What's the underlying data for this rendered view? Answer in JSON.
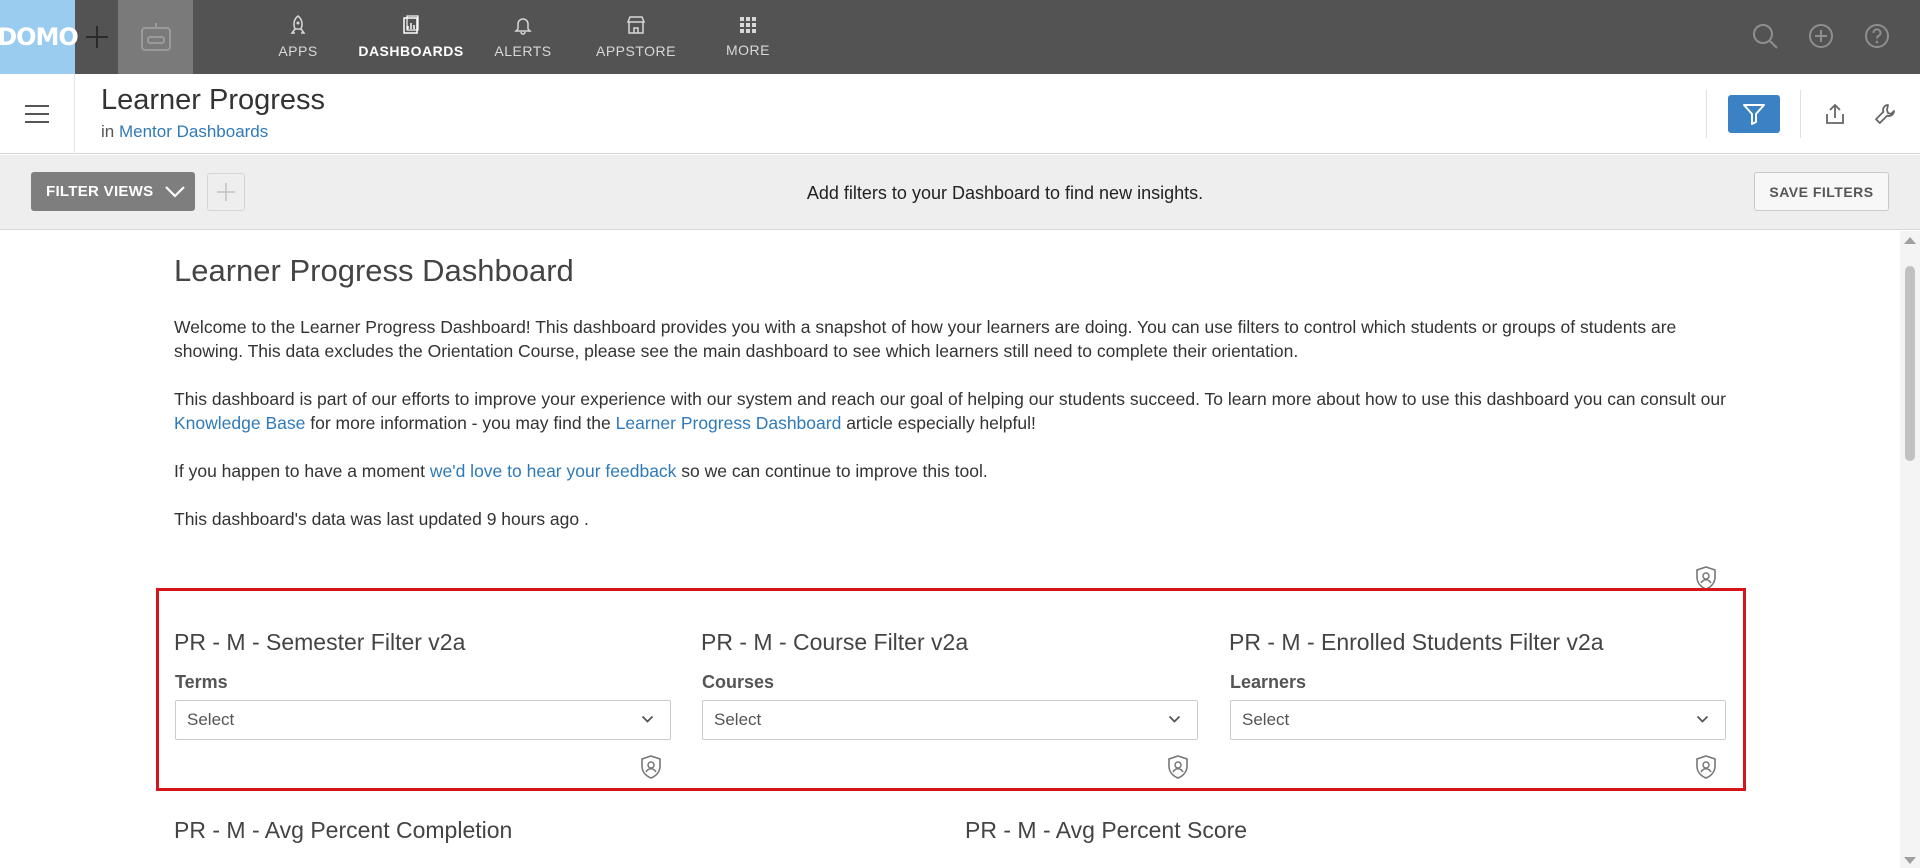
{
  "brand": {
    "logo_text": "DOMO"
  },
  "nav": {
    "items": [
      {
        "label": "APPS",
        "icon": "rocket-icon"
      },
      {
        "label": "DASHBOARDS",
        "icon": "dashboard-icon",
        "active": true
      },
      {
        "label": "ALERTS",
        "icon": "bell-icon"
      },
      {
        "label": "APPSTORE",
        "icon": "store-icon"
      },
      {
        "label": "MORE",
        "icon": "grid-icon"
      }
    ],
    "right_icons": [
      "search-icon",
      "plus-circle-icon",
      "help-icon"
    ]
  },
  "header": {
    "title": "Learner Progress",
    "in_prefix": "in",
    "parent_link": "Mentor Dashboards"
  },
  "filterbar": {
    "filter_views_label": "FILTER VIEWS",
    "message": "Add filters to your Dashboard to find new insights.",
    "save_label": "SAVE FILTERS"
  },
  "main": {
    "title": "Learner Progress Dashboard",
    "para1": "Welcome  to the Learner Progress Dashboard! This dashboard provides you with a snapshot of how your learners are doing. You can use filters to control which students or groups of students are showing. This data excludes the Orientation Course, please see the main dashboard to see which learners still need to complete their orientation.",
    "para2_a": "This dashboard is part of our efforts to improve your experience with our system and reach our goal of helping our students succeed. To learn more about how to use this dashboard you can consult our ",
    "para2_link1": "Knowledge Base",
    "para2_b": " for more information - you may find the ",
    "para2_link2": "Learner Progress Dashboard",
    "para2_c": " article especially helpful!",
    "para3_a": "If you happen to have a moment ",
    "para3_link": "we'd love to hear your feedback",
    "para3_b": " so we can continue to improve this tool.",
    "para4": "This dashboard's data was last updated  9 hours ago ."
  },
  "filters": [
    {
      "title": "PR - M - Semester Filter v2a",
      "label": "Terms",
      "value": "Select"
    },
    {
      "title": "PR - M - Course Filter v2a",
      "label": "Courses",
      "value": "Select"
    },
    {
      "title": "PR - M - Enrolled Students Filter v2a",
      "label": "Learners",
      "value": "Select"
    }
  ],
  "cards_below": [
    {
      "title": "PR - M - Avg Percent Completion"
    },
    {
      "title": "PR - M - Avg Percent Score"
    }
  ],
  "colors": {
    "topnav": "#535353",
    "logo_bg": "#99ccee",
    "accent": "#3a82c4",
    "link": "#2f7ab9",
    "highlight": "#d6141c"
  }
}
